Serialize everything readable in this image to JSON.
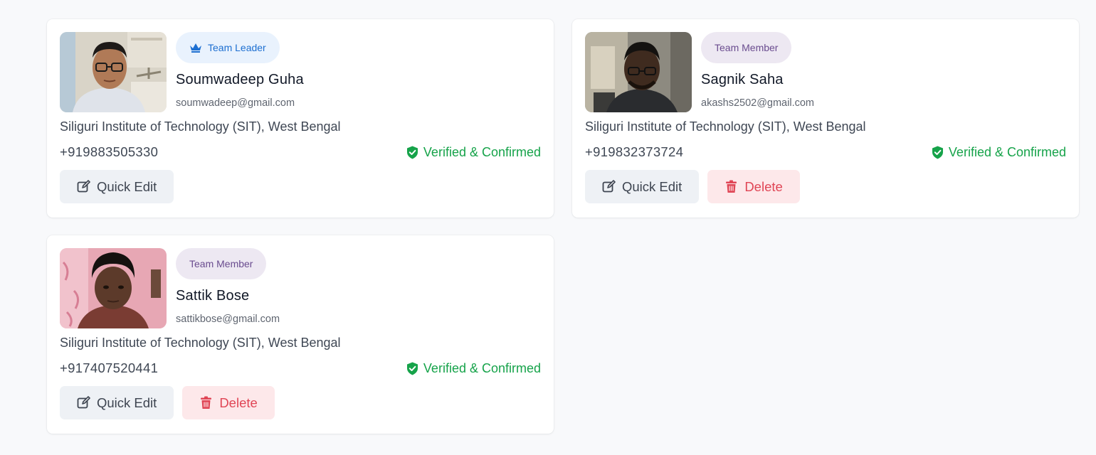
{
  "members": [
    {
      "role": "Team Leader",
      "role_type": "leader",
      "name": "Soumwadeep Guha",
      "email": "soumwadeep@gmail.com",
      "institute": "Siliguri Institute of Technology (SIT), West Bengal",
      "phone": "+919883505330",
      "status": "Verified & Confirmed",
      "edit_label": "Quick Edit"
    },
    {
      "role": "Team Member",
      "role_type": "member",
      "name": "Sagnik Saha",
      "email": "akashs2502@gmail.com",
      "institute": "Siliguri Institute of Technology (SIT), West Bengal",
      "phone": "+919832373724",
      "status": "Verified & Confirmed",
      "edit_label": "Quick Edit",
      "delete_label": "Delete"
    },
    {
      "role": "Team Member",
      "role_type": "member",
      "name": "Sattik Bose",
      "email": "sattikbose@gmail.com",
      "institute": "Siliguri Institute of Technology (SIT), West Bengal",
      "phone": "+917407520441",
      "status": "Verified & Confirmed",
      "edit_label": "Quick Edit",
      "delete_label": "Delete"
    }
  ],
  "colors": {
    "verified": "#16a34a",
    "leader_badge_bg": "#e9f2fd",
    "leader_badge_text": "#1d6fd1",
    "member_badge_bg": "#ede8f2",
    "member_badge_text": "#6a4c8f",
    "delete_bg": "#fde8ea",
    "delete_text": "#e04555"
  },
  "icons": {
    "leader": "crown-icon",
    "verified": "shield-check-icon",
    "edit": "edit-icon",
    "delete": "trash-icon"
  }
}
